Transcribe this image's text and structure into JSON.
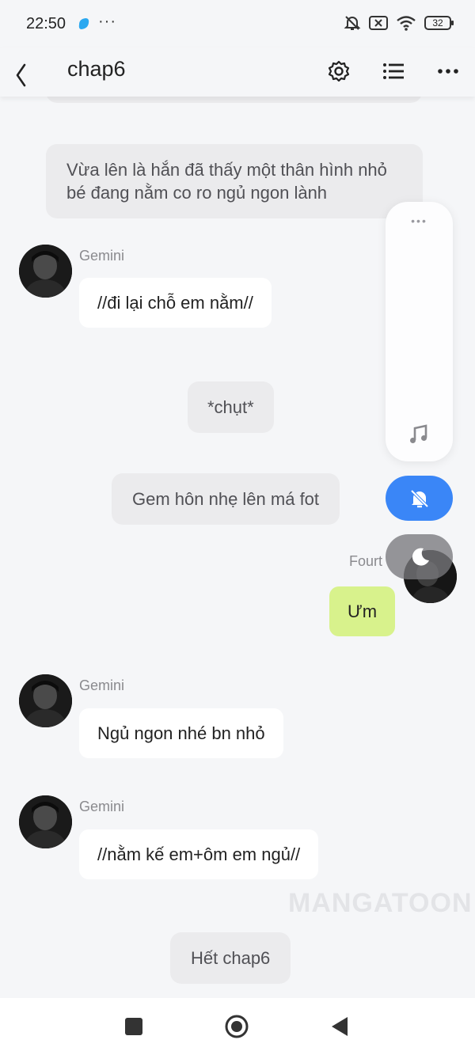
{
  "status_bar": {
    "time": "22:50",
    "dots": "···",
    "battery": "32"
  },
  "header": {
    "title": "chap6"
  },
  "messages": [
    {
      "kind": "narration",
      "text": "Vừa lên là hắn đã thấy một thân hình nhỏ bé đang nằm co ro ngủ ngon lành"
    },
    {
      "kind": "left",
      "speaker": "Gemini",
      "text": "//đi lại chỗ em nằm//"
    },
    {
      "kind": "narration",
      "text": "*chụt*"
    },
    {
      "kind": "narration",
      "text": "Gem hôn nhẹ lên má fot"
    },
    {
      "kind": "right",
      "speaker": "Fourt",
      "text": "Ưm"
    },
    {
      "kind": "left",
      "speaker": "Gemini",
      "text": "Ngủ ngon nhé bn nhỏ"
    },
    {
      "kind": "left",
      "speaker": "Gemini",
      "text": "//nằm kế em+ôm em ngủ//"
    },
    {
      "kind": "narration",
      "text": "Hết chap6"
    }
  ],
  "floating_panel": {
    "dots": "•••"
  },
  "watermark": "MANGATOON",
  "colors": {
    "accent": "#3a86f7",
    "right_bubble": "#d8f28c",
    "narration": "#ebebed"
  }
}
